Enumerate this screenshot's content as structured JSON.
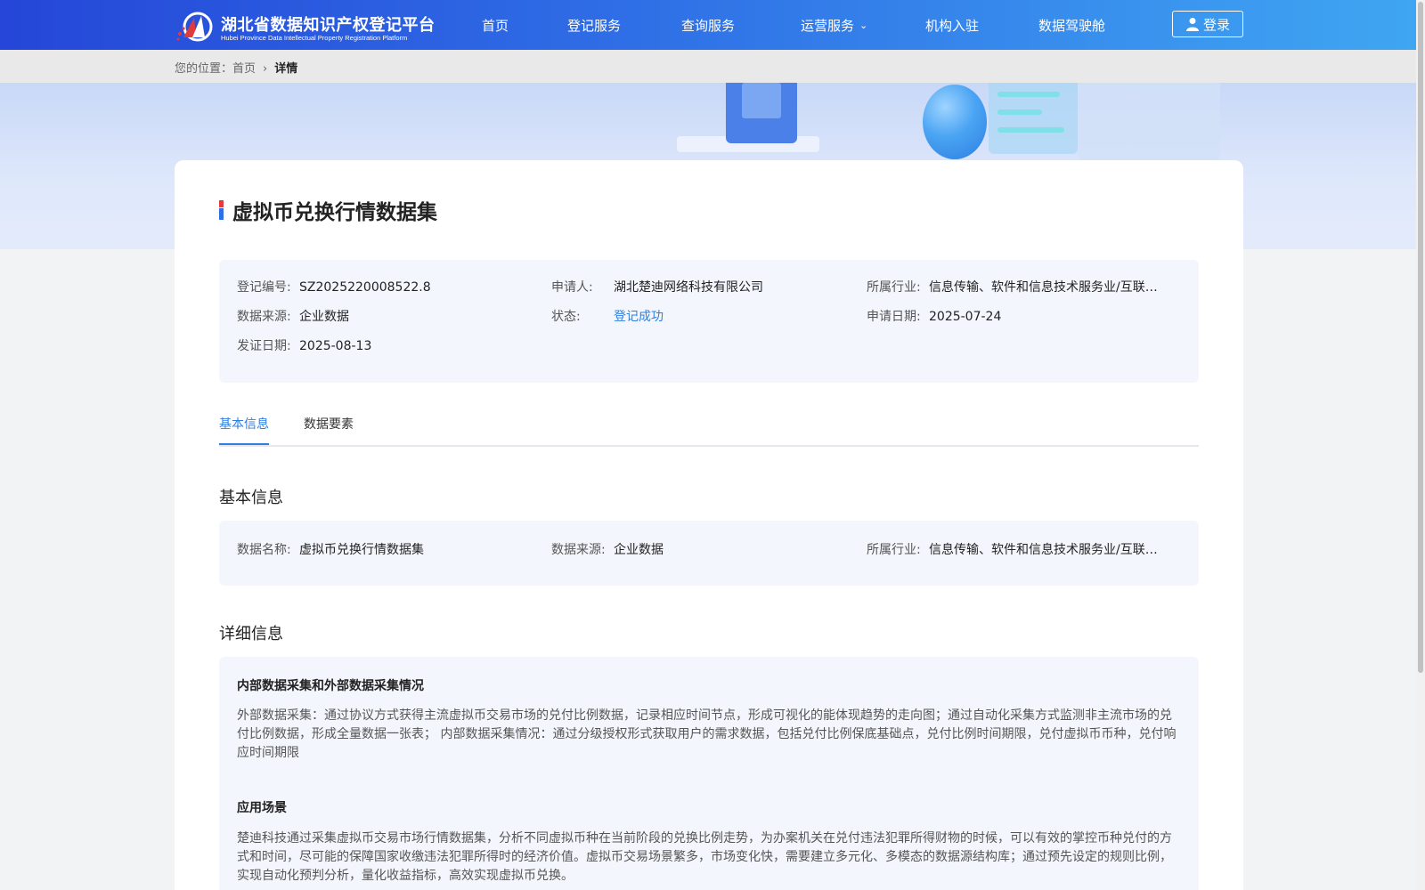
{
  "header": {
    "logo_cn": "湖北省数据知识产权登记平台",
    "logo_en": "Hubei Province Data Intellectual Property Registration Platform",
    "nav": [
      "首页",
      "登记服务",
      "查询服务",
      "运营服务",
      "机构入驻",
      "数据驾驶舱"
    ],
    "login_label": "登录"
  },
  "breadcrumb": {
    "prefix": "您的位置：",
    "home": "首页",
    "current": "详情"
  },
  "detail": {
    "title": "虚拟币兑换行情数据集",
    "summary": {
      "reg_no_label": "登记编号:",
      "reg_no": "SZ2025220008522.8",
      "applicant_label": "申请人:",
      "applicant": "湖北楚迪网络科技有限公司",
      "industry_label": "所属行业:",
      "industry": "信息传输、软件和信息技术服务业/互联网...",
      "source_label": "数据来源:",
      "source": "企业数据",
      "status_label": "状态:",
      "status": "登记成功",
      "apply_date_label": "申请日期:",
      "apply_date": "2025-07-24",
      "issue_date_label": "发证日期:",
      "issue_date": "2025-08-13"
    },
    "tabs": [
      "基本信息",
      "数据要素"
    ],
    "basic": {
      "heading": "基本信息",
      "name_label": "数据名称:",
      "name": "虚拟币兑换行情数据集",
      "source_label": "数据来源:",
      "source": "企业数据",
      "industry_label": "所属行业:",
      "industry": "信息传输、软件和信息技术服务业/互联网..."
    },
    "more": {
      "heading": "详细信息",
      "collection_title": "内部数据采集和外部数据采集情况",
      "collection_text": "外部数据采集：通过协议方式获得主流虚拟币交易市场的兑付比例数据，记录相应时间节点，形成可视化的能体现趋势的走向图；通过自动化采集方式监测非主流市场的兑付比例数据，形成全量数据一张表； 内部数据采集情况：通过分级授权形式获取用户的需求数据，包括兑付比例保底基础点，兑付比例时间期限，兑付虚拟币币种，兑付响应时间期限",
      "scenario_title": "应用场景",
      "scenario_text": "楚迪科技通过采集虚拟币交易市场行情数据集，分析不同虚拟币种在当前阶段的兑换比例走势，为办案机关在兑付违法犯罪所得财物的时候，可以有效的掌控币种兑付的方式和时间，尽可能的保障国家收缴违法犯罪所得时的经济价值。虚拟币交易场景繁多，市场变化快，需要建立多元化、多模态的数据源结构库；通过预先设定的规则比例，实现自动化预判分析，量化收益指标，高效实现虚拟币兑换。"
    }
  },
  "colors": {
    "header_start": "#2546d8",
    "header_end": "#3fa6f2",
    "accent": "#2f7fe0",
    "panel_bg": "#f3f6fc"
  }
}
